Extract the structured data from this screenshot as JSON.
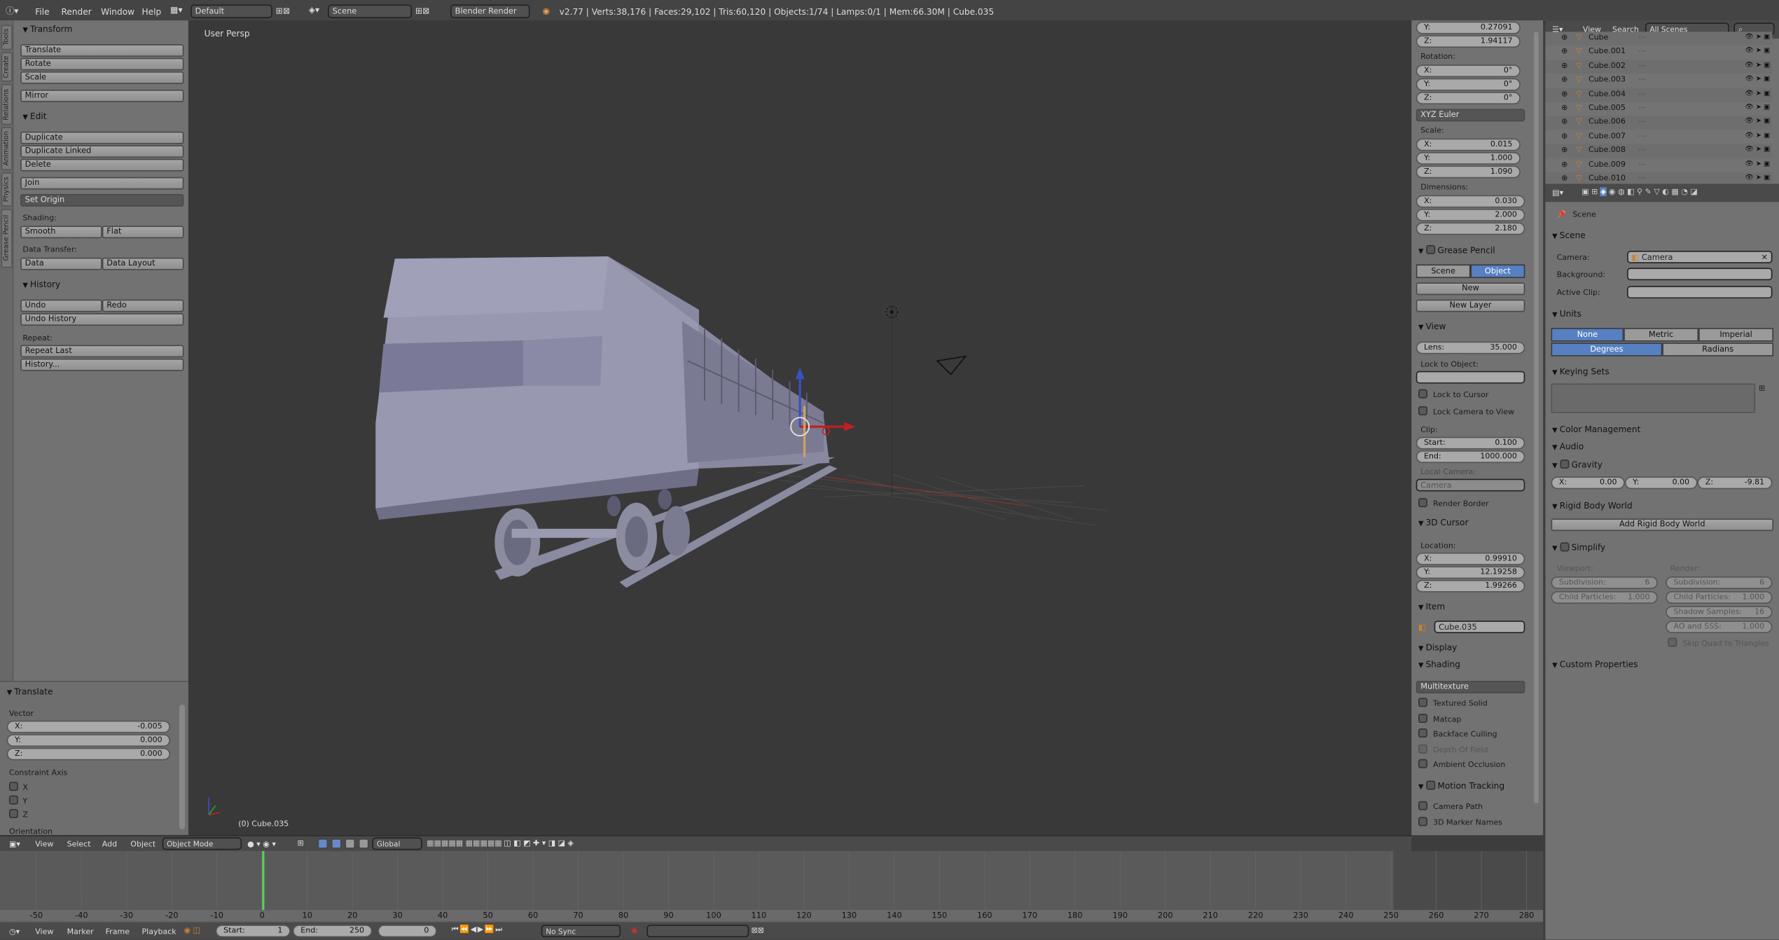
{
  "topbar": {
    "menu": [
      "File",
      "Render",
      "Window",
      "Help"
    ],
    "layout": "Default",
    "scene": "Scene",
    "engine": "Blender Render",
    "stats": "v2.77 | Verts:38,176 | Faces:29,102 | Tris:60,120 | Objects:1/74 | Lamps:0/1 | Mem:66.30M | Cube.035"
  },
  "left": {
    "tabs": [
      "Tools",
      "Create",
      "Relations",
      "Animation",
      "Physics",
      "Grease Pencil"
    ],
    "transform_header": "Transform",
    "transform": [
      "Translate",
      "Rotate",
      "Scale"
    ],
    "mirror": "Mirror",
    "edit_header": "Edit",
    "edit": [
      "Duplicate",
      "Duplicate Linked",
      "Delete"
    ],
    "join": "Join",
    "set_origin": "Set Origin",
    "shading_label": "Shading:",
    "smooth": "Smooth",
    "flat": "Flat",
    "data_transfer_label": "Data Transfer:",
    "data": "Data",
    "data_layout": "Data Layout",
    "history_header": "History",
    "undo": "Undo",
    "redo": "Redo",
    "undo_history": "Undo History",
    "repeat_label": "Repeat:",
    "repeat_last": "Repeat Last",
    "history": "History...",
    "op_header": "Translate",
    "vector_label": "Vector",
    "vx": "-0.005",
    "vy": "0.000",
    "vz": "0.000",
    "constraint_label": "Constraint Axis",
    "axes": [
      "X",
      "Y",
      "Z"
    ],
    "orientation": "Orientation"
  },
  "viewport": {
    "label": "User Persp",
    "object": "(0) Cube.035"
  },
  "viewport_header": {
    "view": "View",
    "select": "Select",
    "add": "Add",
    "object": "Object",
    "mode": "Object Mode",
    "orientation": "Global"
  },
  "npanel": {
    "loc_y": "0.27091",
    "loc_z": "1.94117",
    "rotation_label": "Rotation:",
    "rx": "0°",
    "ry": "0°",
    "rz": "0°",
    "euler": "XYZ Euler",
    "scale_label": "Scale:",
    "sx": "0.015",
    "sy": "1.000",
    "sz": "1.090",
    "dim_label": "Dimensions:",
    "dx": "0.030",
    "dy": "2.000",
    "dz": "2.180",
    "gp_header": "Grease Pencil",
    "gp_scene": "Scene",
    "gp_object": "Object",
    "gp_new": "New",
    "gp_new_layer": "New Layer",
    "view_header": "View",
    "lens": "35.000",
    "lock_obj": "Lock to Object:",
    "lock_cursor": "Lock to Cursor",
    "lock_cam": "Lock Camera to View",
    "clip_label": "Clip:",
    "clip_start": "0.100",
    "clip_end": "1000.000",
    "local_camera": "Local Camera:",
    "camera": "Camera",
    "render_border": "Render Border",
    "cursor_header": "3D Cursor",
    "loc_label": "Location:",
    "cx": "0.99910",
    "cy": "12.19258",
    "cz": "1.99266",
    "item_header": "Item",
    "item_name": "Cube.035",
    "display_header": "Display",
    "shading_header": "Shading",
    "multitexture": "Multitexture",
    "shading_opts": [
      "Textured Solid",
      "Matcap",
      "Backface Culling",
      "Depth Of Field",
      "Ambient Occlusion"
    ],
    "motion_header": "Motion Tracking",
    "camera_path": "Camera Path",
    "marker_names": "3D Marker Names"
  },
  "outliner": {
    "view": "View",
    "search": "Search",
    "scenes": "All Scenes",
    "items": [
      "Cube",
      "Cube.001",
      "Cube.002",
      "Cube.003",
      "Cube.004",
      "Cube.005",
      "Cube.006",
      "Cube.007",
      "Cube.008",
      "Cube.009",
      "Cube.010"
    ]
  },
  "props": {
    "scene": "Scene",
    "scene_header": "Scene",
    "camera_label": "Camera:",
    "camera": "Camera",
    "background_label": "Background:",
    "active_clip_label": "Active Clip:",
    "units_header": "Units",
    "unit_none": "None",
    "unit_metric": "Metric",
    "unit_imperial": "Imperial",
    "degrees": "Degrees",
    "radians": "Radians",
    "keying_header": "Keying Sets",
    "color_mgmt": "Color Management",
    "audio": "Audio",
    "gravity": "Gravity",
    "gx": "0.00",
    "gy": "0.00",
    "gz": "-9.81",
    "rbw_header": "Rigid Body World",
    "add_rbw": "Add Rigid Body World",
    "simplify": "Simplify",
    "viewport_label": "Viewport:",
    "render_label": "Render:",
    "subdiv": "Subdivision:",
    "subdiv_v": "6",
    "child": "Child Particles:",
    "child_v": "1.000",
    "shadow": "Shadow Samples:",
    "shadow_v": "16",
    "ao": "AO and SSS:",
    "ao_v": "1.000",
    "skip_quad": "Skip Quad to Triangles",
    "custom_props": "Custom Properties"
  },
  "timeline": {
    "ticks": [
      "-50",
      "-40",
      "-30",
      "-20",
      "-10",
      "0",
      "10",
      "20",
      "30",
      "40",
      "50",
      "60",
      "70",
      "80",
      "90",
      "100",
      "110",
      "120",
      "130",
      "140",
      "150",
      "160",
      "170",
      "180",
      "190",
      "200",
      "210",
      "220",
      "230",
      "240",
      "250",
      "260",
      "270",
      "280"
    ],
    "menu": [
      "View",
      "Marker",
      "Frame",
      "Playback"
    ],
    "start": "Start:",
    "start_v": "1",
    "end": "End:",
    "end_v": "250",
    "frame": "0",
    "sync": "No Sync"
  }
}
